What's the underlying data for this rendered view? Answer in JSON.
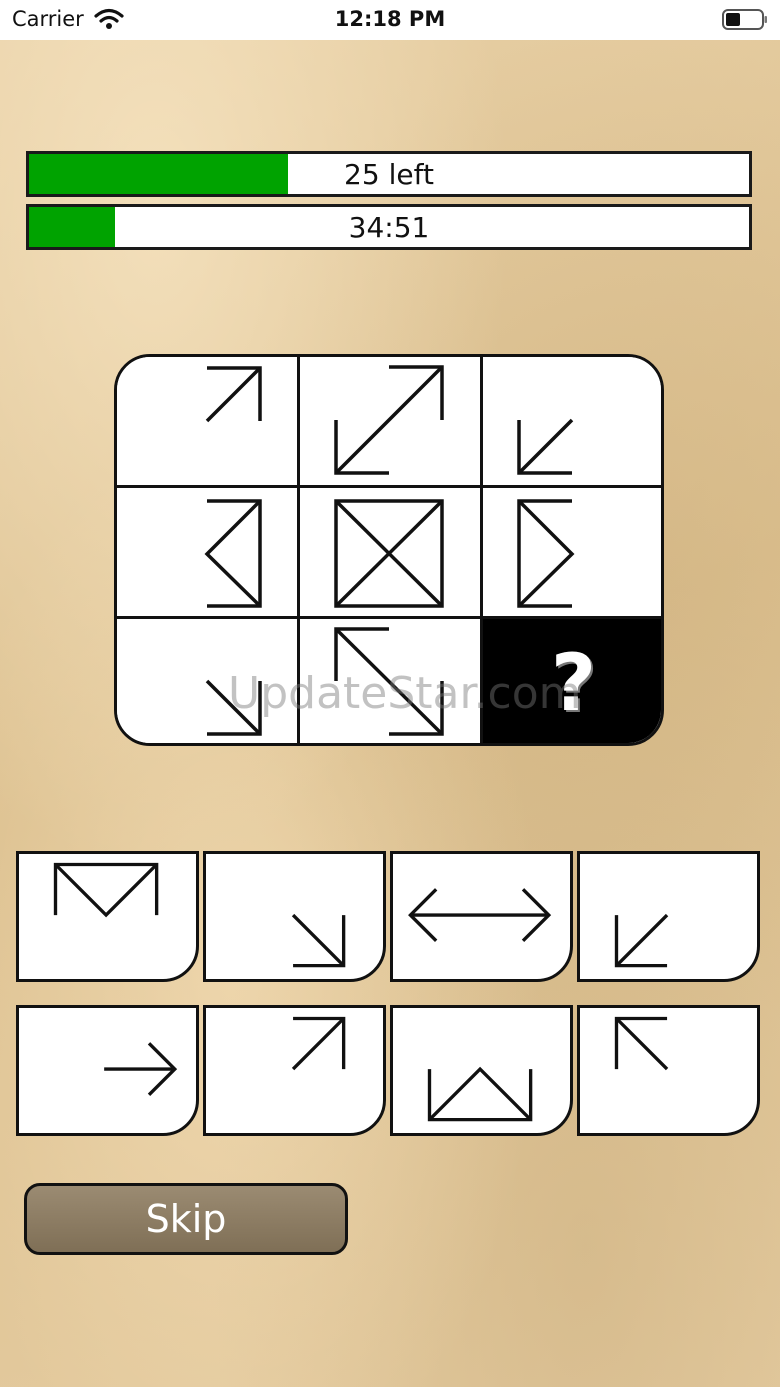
{
  "status_bar": {
    "carrier": "Carrier",
    "time": "12:18 PM"
  },
  "progress": {
    "remaining_label": "25 left",
    "remaining_fraction": 0.36,
    "timer_label": "34:51",
    "timer_fraction": 0.12,
    "fill_color": "#00a300"
  },
  "puzzle": {
    "missing_symbol": "?",
    "cells": [
      "arrow-up-right",
      "double-arrow-diagonal",
      "arrow-down-left",
      "bracket-left-triangle",
      "crossed-square",
      "bracket-right-triangle",
      "arrow-down-right",
      "double-arrow-diagonal-nw-se",
      "unknown"
    ]
  },
  "options": [
    "envelope-open-top",
    "arrow-down-right",
    "double-arrow-horizontal",
    "arrow-down-left",
    "arrow-right",
    "arrow-up-right",
    "envelope-open-bottom",
    "arrow-up-left"
  ],
  "watermark": "UpdateStar.com",
  "skip_label": "Skip"
}
